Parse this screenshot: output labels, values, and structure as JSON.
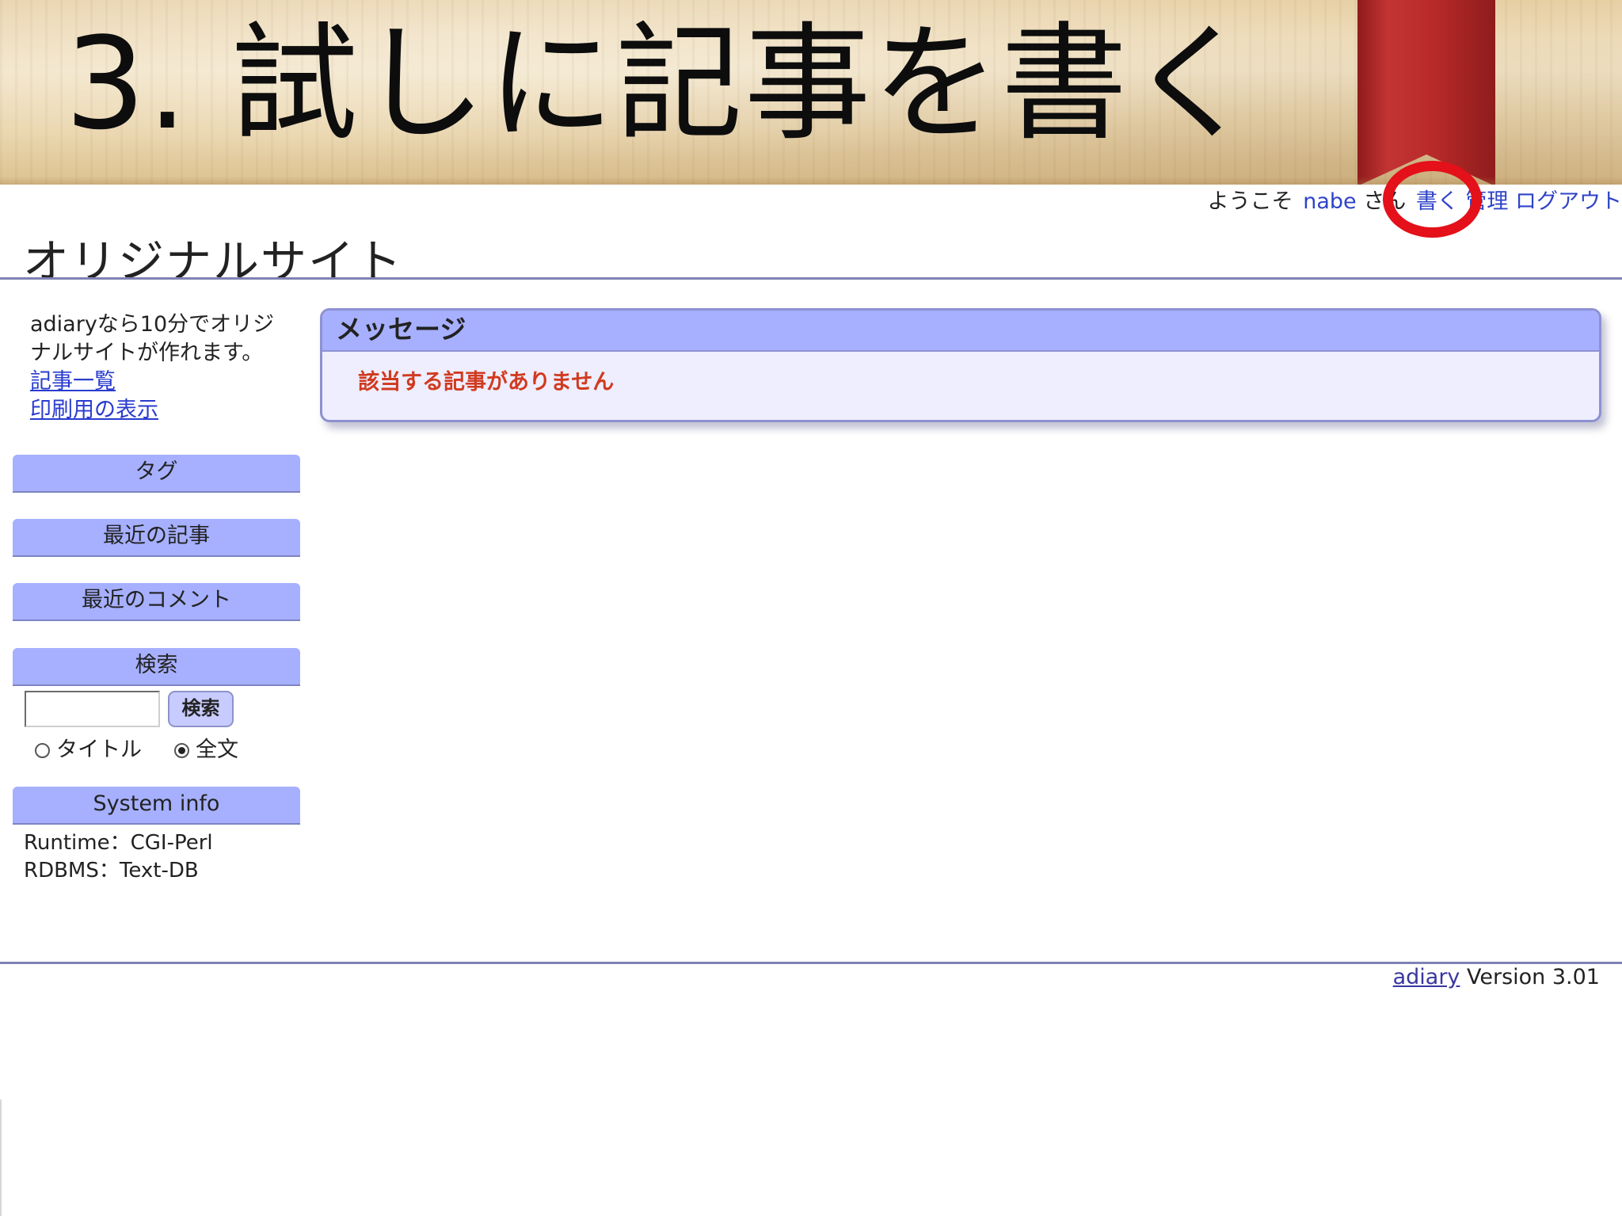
{
  "slide": {
    "title": "3. 試しに記事を書く"
  },
  "topbar": {
    "welcome": "ようこそ",
    "user": "nabe",
    "suffix": "さん",
    "write_link": "書く",
    "admin_link": "管理",
    "logout_link": "ログアウト"
  },
  "site": {
    "title": "オリジナルサイト"
  },
  "sidebar": {
    "intro_text": "adiaryなら10分でオリジナルサイトが作れます。",
    "links": [
      "記事一覧",
      "印刷用の表示"
    ],
    "sections": {
      "tags": "タグ",
      "recent_articles": "最近の記事",
      "recent_comments": "最近のコメント",
      "search": "検索",
      "system_info": "System info"
    },
    "search": {
      "input_value": "",
      "button_label": "検索",
      "radio_title": "タイトル",
      "radio_fulltext": "全文",
      "selected": "全文"
    },
    "system_info": {
      "runtime": "Runtime：CGI-Perl",
      "rdbms": "RDBMS：Text-DB"
    }
  },
  "message": {
    "header": "メッセージ",
    "body": "該当する記事がありません"
  },
  "footer": {
    "link": "adiary",
    "version": "Version 3.01"
  },
  "colors": {
    "accent": "#a6b0ff",
    "link": "#2f43c8",
    "error_text": "#d13a1f",
    "highlight_ring": "#e4101a",
    "bookmark": "#b82a2a"
  }
}
